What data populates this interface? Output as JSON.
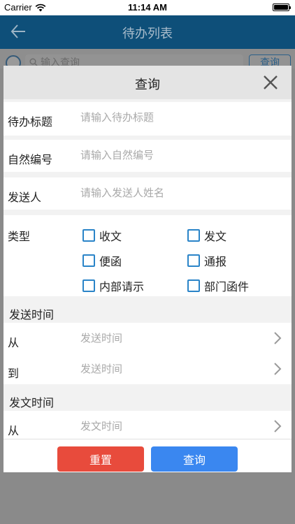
{
  "status_bar": {
    "carrier": "Carrier",
    "time": "11:14 AM"
  },
  "nav": {
    "title": "待办列表"
  },
  "search": {
    "placeholder": "输入查询",
    "button_label": "查询"
  },
  "modal": {
    "title": "查询",
    "fields": [
      {
        "label": "待办标题",
        "placeholder": "请输入待办标题"
      },
      {
        "label": "自然编号",
        "placeholder": "请输入自然编号"
      },
      {
        "label": "发送人",
        "placeholder": "请输入发送人姓名"
      }
    ],
    "type_label": "类型",
    "types": [
      "收文",
      "发文",
      "便函",
      "通报",
      "内部请示",
      "部门函件"
    ],
    "send_time": {
      "title": "发送时间",
      "from_label": "从",
      "to_label": "到",
      "placeholder": "发送时间"
    },
    "doc_time": {
      "title": "发文时间",
      "from_label": "从",
      "placeholder": "发文时间"
    },
    "reset_label": "重置",
    "query_label": "查询"
  },
  "colors": {
    "nav": "#0e4f79",
    "checkbox": "#2a84c8",
    "reset": "#e84b3c",
    "query": "#3a87f0"
  }
}
